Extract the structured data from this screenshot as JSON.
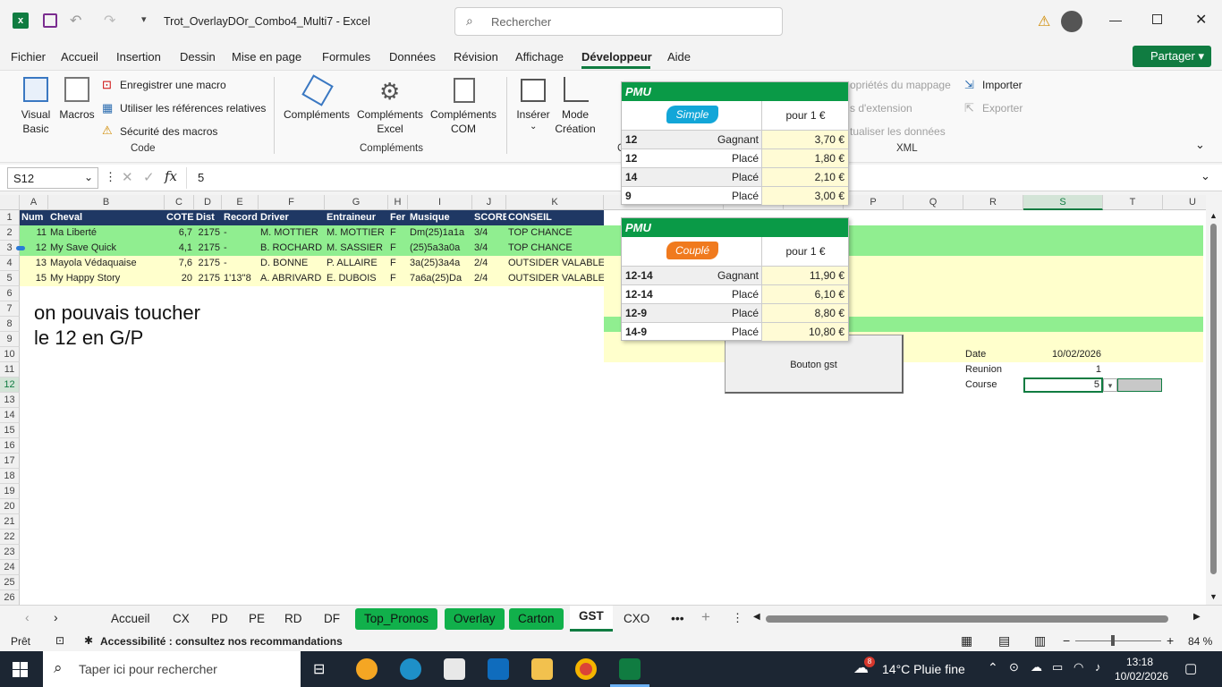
{
  "title": {
    "filename": "Trot_OverlayDOr_Combo4_Multi7  -  Excel",
    "search_placeholder": "Rechercher"
  },
  "menu": [
    "Fichier",
    "Accueil",
    "Insertion",
    "Dessin",
    "Mise en page",
    "Formules",
    "Données",
    "Révision",
    "Affichage",
    "Développeur",
    "Aide"
  ],
  "share_label": "Partager",
  "ribbon": {
    "code": {
      "visual_basic": "Visual Basic",
      "macros": "Macros",
      "record_macro": "Enregistrer une macro",
      "relative_refs": "Utiliser les références relatives",
      "macro_security": "Sécurité des macros",
      "group": "Code"
    },
    "complements": {
      "c1": "Compléments",
      "c2": "Compléments Excel",
      "c3": "Compléments COM",
      "group": "Compléments"
    },
    "controls": {
      "insert": "Insérer",
      "design": "Mode Création",
      "group_fragment": "C"
    },
    "xml": {
      "map_props": "opriétés du mappage",
      "extension": "s d'extension",
      "refresh": "tualiser les données",
      "import": "Importer",
      "export": "Exporter",
      "group": "XML"
    }
  },
  "formula": {
    "name_box": "S12",
    "value": "5"
  },
  "columns": [
    "A",
    "B",
    "C",
    "D",
    "E",
    "F",
    "G",
    "H",
    "I",
    "J",
    "K",
    "",
    "",
    "",
    "P",
    "Q",
    "R",
    "S",
    "T",
    "U"
  ],
  "headers": {
    "num": "Num",
    "cheval": "Cheval",
    "cote": "COTE",
    "dist": "Dist",
    "record": "Record",
    "driver": "Driver",
    "entraineur": "Entraineur",
    "fer": "Fer",
    "musique": "Musique",
    "score": "SCORE",
    "conseil": "CONSEIL"
  },
  "rows": [
    {
      "num": "11",
      "cheval": "Ma Liberté",
      "cote": "6,7",
      "dist": "2175",
      "record": "-",
      "driver": "M. MOTTIER",
      "entraineur": "M. MOTTIER",
      "fer": "F",
      "musique": "Dm(25)1a1a",
      "score": "3/4",
      "conseil": "TOP CHANCE"
    },
    {
      "num": "12",
      "cheval": "My Save Quick",
      "cote": "4,1",
      "dist": "2175",
      "record": "-",
      "driver": "B. ROCHARD",
      "entraineur": "M. SASSIER",
      "fer": "F",
      "musique": "(25)5a3a0a",
      "score": "3/4",
      "conseil": "TOP CHANCE"
    },
    {
      "num": "13",
      "cheval": "Mayola Védaquaise",
      "cote": "7,6",
      "dist": "2175",
      "record": "-",
      "driver": "D. BONNE",
      "entraineur": "P. ALLAIRE",
      "fer": "F",
      "musique": "3a(25)3a4a",
      "score": "2/4",
      "conseil": "OUTSIDER VALABLE"
    },
    {
      "num": "15",
      "cheval": "My Happy Story",
      "cote": "20",
      "dist": "2175",
      "record": "1'13''8",
      "driver": "A. ABRIVARD",
      "entraineur": "E. DUBOIS",
      "fer": "F",
      "musique": "7a6a(25)Da",
      "score": "2/4",
      "conseil": "OUTSIDER VALABLE"
    }
  ],
  "note": {
    "line1": "on pouvais toucher",
    "line2": "le 12 en G/P"
  },
  "info": {
    "date_label": "Date",
    "date_value": "10/02/2026",
    "reunion_label": "Reunion",
    "reunion_value": "1",
    "course_label": "Course",
    "course_value": "5"
  },
  "button_gst": "Bouton gst",
  "pmu_simple": {
    "brand": "PMU",
    "badge": "Simple",
    "header": "pour 1 €",
    "rows": [
      {
        "n": "12",
        "t": "Gagnant",
        "v": "3,70 €"
      },
      {
        "n": "12",
        "t": "Placé",
        "v": "1,80 €"
      },
      {
        "n": "14",
        "t": "Placé",
        "v": "2,10 €"
      },
      {
        "n": "9",
        "t": "Placé",
        "v": "3,00 €"
      }
    ]
  },
  "pmu_couple": {
    "brand": "PMU",
    "badge": "Couplé",
    "header": "pour 1 €",
    "rows": [
      {
        "n": "12-14",
        "t": "Gagnant",
        "v": "11,90 €"
      },
      {
        "n": "12-14",
        "t": "Placé",
        "v": "6,10 €"
      },
      {
        "n": "12-9",
        "t": "Placé",
        "v": "8,80 €"
      },
      {
        "n": "14-9",
        "t": "Placé",
        "v": "10,80 €"
      }
    ]
  },
  "sheet_tabs": [
    "Accueil",
    "CX",
    "PD",
    "PE",
    "RD",
    "DF",
    "Top_Pronos",
    "Overlay",
    "Carton",
    "GST",
    "CXO"
  ],
  "status": {
    "ready": "Prêt",
    "accessibility": "Accessibilité : consultez nos recommandations",
    "zoom": "84 %"
  },
  "taskbar": {
    "search": "Taper ici pour rechercher",
    "weather": "14°C  Pluie fine",
    "time": "13:18",
    "date": "10/02/2026",
    "badge": "8"
  },
  "colors": {
    "green_row": "#90ee90",
    "yellow_row": "#ffffcc",
    "header_navy": "#1f3864",
    "pmu_green": "#0a9a47",
    "sheet_tab_green": "#11b04b"
  }
}
